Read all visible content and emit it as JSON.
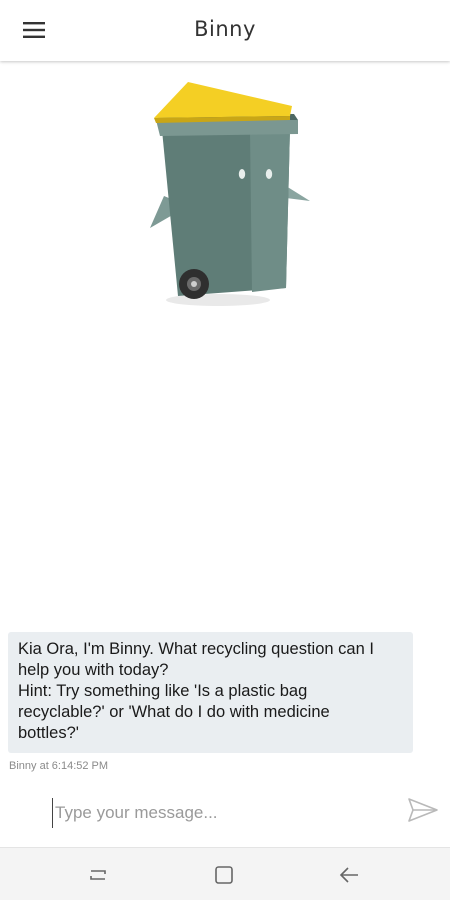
{
  "header": {
    "title": "Binny",
    "menu_icon": "hamburger-menu-icon"
  },
  "mascot": {
    "icon": "binny-wheelie-bin-mascot",
    "lid_color": "#f4cf24",
    "body_color": "#5f7d77"
  },
  "chat": {
    "messages": [
      {
        "sender": "Binny",
        "lines": [
          "Kia Ora, I'm Binny. What recycling question can I",
          "help you with today?",
          "Hint: Try something like 'Is a plastic bag",
          "recyclable?' or 'What do I do with medicine",
          "bottles?'"
        ],
        "meta": "Binny at 6:14:52 PM"
      }
    ],
    "bubble_color": "#eaeef1"
  },
  "composer": {
    "placeholder": "Type your message...",
    "value": "",
    "send_icon": "send-icon"
  },
  "navbar": {
    "buttons": [
      "recent-apps-icon",
      "home-icon",
      "back-icon"
    ]
  }
}
